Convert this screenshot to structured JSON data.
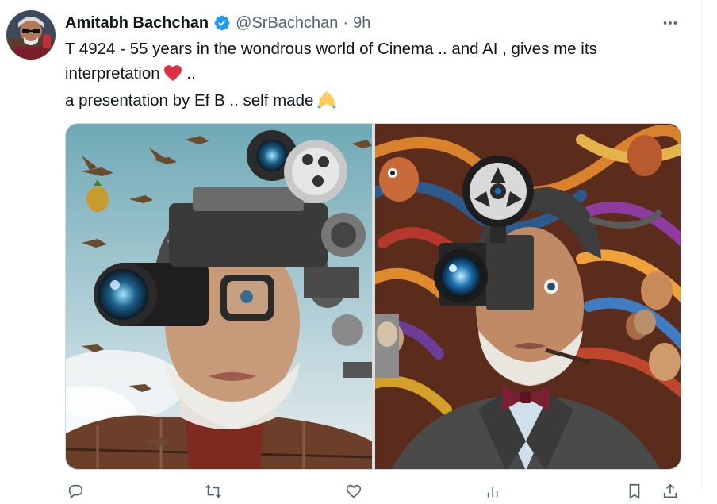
{
  "tweet": {
    "author_name": "Amitabh Bachchan",
    "handle": "@SrBachchan",
    "separator": "·",
    "time": "9h",
    "text_line1": "T 4924 - 55 years in the wondrous world of Cinema .. and AI , gives me its",
    "text_line2": "interpretation",
    "text_line2_suffix": " ..",
    "text_line3": "a presentation by Ef B .. self made",
    "emoji_line2": "red-heart-emoji",
    "emoji_line3": "folded-hands-emoji"
  },
  "icons": {
    "verified": "verified-badge-icon",
    "more": "more-options-icon",
    "reply": "reply-icon",
    "retweet": "retweet-icon",
    "like": "like-icon",
    "views": "views-icon",
    "bookmark": "bookmark-icon",
    "share": "share-icon"
  },
  "colors": {
    "verified_blue": "#1d9bf0",
    "text_primary": "#0f1419",
    "text_secondary": "#536471",
    "heart_red": "#dd2e44"
  }
}
